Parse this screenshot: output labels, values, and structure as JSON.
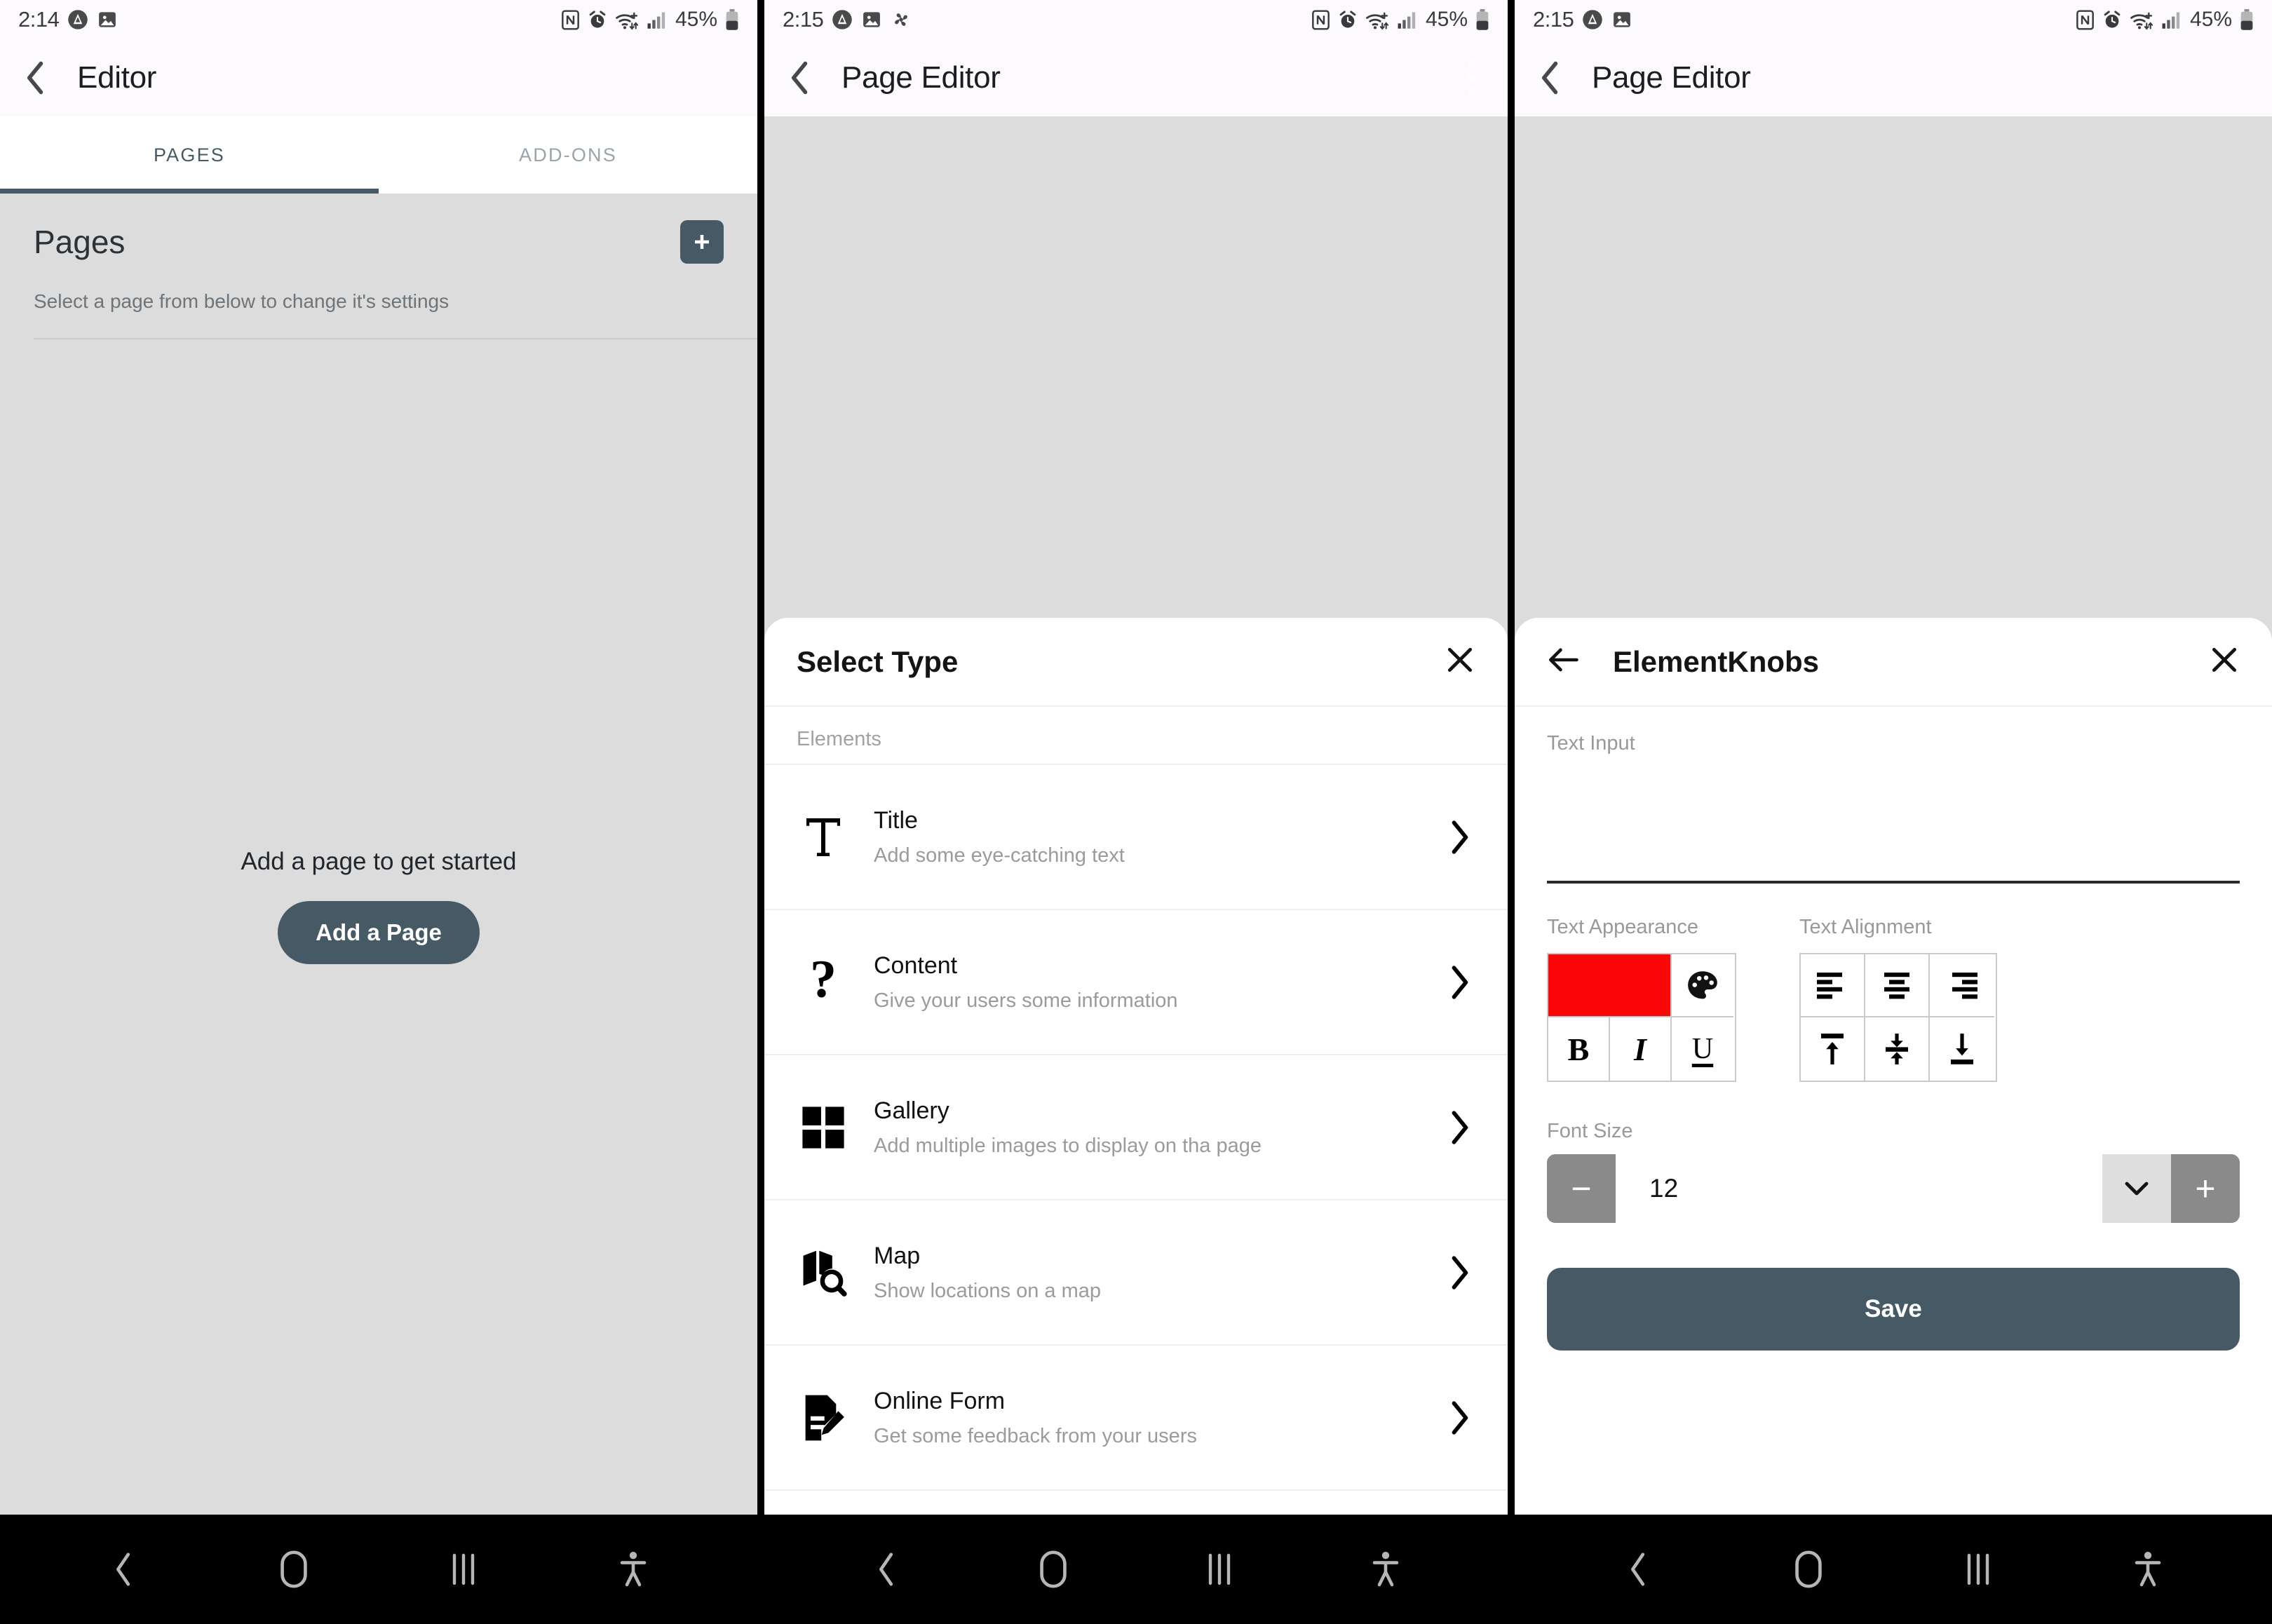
{
  "colors": {
    "accent": "#465a66",
    "swatch_red": "#fb0707",
    "sheet_bg": "#ffffff",
    "page_bg": "#dcdcdc",
    "header_bg": "#fdfaff"
  },
  "screens": [
    {
      "status": {
        "time": "2:14",
        "battery_percent": "45%"
      },
      "appbar": {
        "title": "Editor"
      },
      "tabs": [
        {
          "label": "PAGES",
          "active": true
        },
        {
          "label": "ADD-ONS",
          "active": false
        }
      ],
      "pages": {
        "title": "Pages",
        "subtitle": "Select a page from below to change it's settings",
        "empty_text": "Add a page to get started",
        "add_button": "Add a Page"
      }
    },
    {
      "status": {
        "time": "2:15",
        "battery_percent": "45%"
      },
      "appbar": {
        "title": "Page Editor"
      },
      "sheet": {
        "title": "Select Type",
        "section_label": "Elements",
        "items": [
          {
            "icon": "title-icon",
            "name": "Title",
            "desc": "Add some eye-catching text"
          },
          {
            "icon": "question-icon",
            "name": "Content",
            "desc": "Give your users some information"
          },
          {
            "icon": "gallery-icon",
            "name": "Gallery",
            "desc": "Add multiple images to display on tha page"
          },
          {
            "icon": "map-search-icon",
            "name": "Map",
            "desc": "Show locations on a map"
          },
          {
            "icon": "form-edit-icon",
            "name": "Online Form",
            "desc": "Get some feedback from your users"
          }
        ]
      }
    },
    {
      "status": {
        "time": "2:15",
        "battery_percent": "45%"
      },
      "appbar": {
        "title": "Page Editor"
      },
      "knobs": {
        "title": "ElementKnobs",
        "text_input_label": "Text Input",
        "text_input_value": "",
        "text_appearance_label": "Text Appearance",
        "text_alignment_label": "Text Alignment",
        "appearance_buttons": [
          "color-swatch",
          "palette",
          "bold",
          "italic",
          "underline"
        ],
        "alignment_buttons": [
          "align-left",
          "align-center",
          "align-right",
          "valign-top",
          "valign-middle",
          "valign-bottom"
        ],
        "bold_glyph": "B",
        "italic_glyph": "I",
        "underline_glyph": "U",
        "font_size_label": "Font Size",
        "font_size_value": "12",
        "minus_glyph": "−",
        "plus_glyph": "+",
        "save_label": "Save"
      }
    }
  ],
  "navbar": {
    "items": [
      "back-icon",
      "home-icon",
      "recents-icon",
      "accessibility-icon"
    ]
  }
}
